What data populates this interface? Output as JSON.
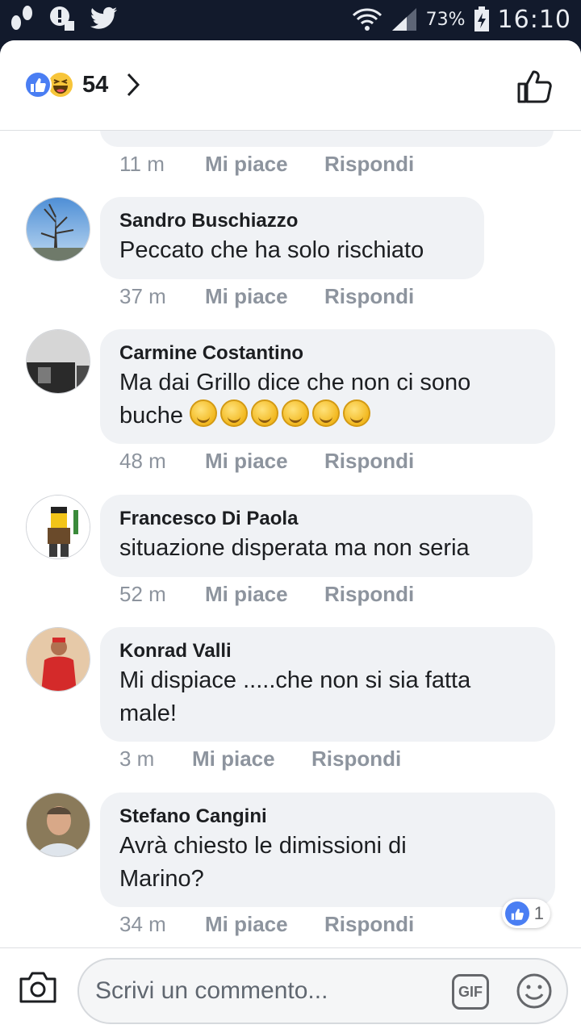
{
  "status_bar": {
    "battery": "73%",
    "time": "16:10"
  },
  "header": {
    "reaction_count": "54"
  },
  "comments": [
    {
      "author": "Sandro Buschiazzo",
      "text": "Peccato che ha solo rischiato",
      "time": "37 m"
    },
    {
      "author": "Carmine Costantino",
      "text_line1": "Ma dai Grillo dice che non ci sono",
      "text_line2": "buche",
      "time": "48 m"
    },
    {
      "author": "Francesco Di Paola",
      "text": "situazione disperata ma non seria",
      "time": "52 m"
    },
    {
      "author": "Konrad Valli",
      "text_line1": "Mi dispiace .....che non si sia fatta",
      "text_line2": "male!",
      "time": "3 m"
    },
    {
      "author": "Stefano Cangini",
      "text_line1": "Avrà chiesto le dimissioni di",
      "text_line2": "Marino?",
      "time": "34 m",
      "reaction_count": "1"
    }
  ],
  "previous_comment": {
    "time": "11 m"
  },
  "actions": {
    "like": "Mi piace",
    "reply": "Rispondi"
  },
  "composer": {
    "placeholder": "Scrivi un commento...",
    "gif_label": "GIF"
  },
  "colors": {
    "accent": "#4a7ef3",
    "bubble": "#f0f2f5",
    "meta": "#8d949e"
  }
}
